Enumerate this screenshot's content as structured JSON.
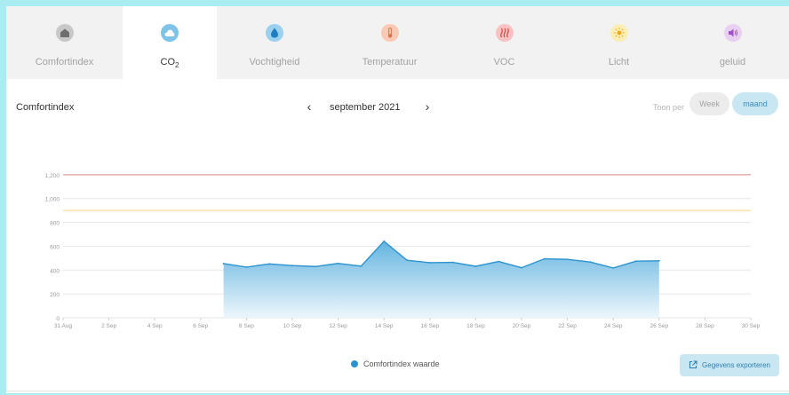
{
  "tabs": [
    {
      "label": "Comfortindex",
      "icon": "house-icon",
      "color": "#c8c8c8",
      "glyph": "#6e6e6e",
      "active": false,
      "width": 131
    },
    {
      "label": "CO",
      "sub": "2",
      "icon": "cloud-icon",
      "color": "#7fc4e8",
      "glyph": "#ffffff",
      "active": true,
      "width": 106
    },
    {
      "label": "Vochtigheid",
      "icon": "droplet-icon",
      "color": "#9cd0ef",
      "glyph": "#1d7fc1",
      "active": false,
      "width": 130
    },
    {
      "label": "Temperatuur",
      "icon": "thermometer-icon",
      "color": "#f9c9b3",
      "glyph": "#e06c4d",
      "active": false,
      "width": 129
    },
    {
      "label": "VOC",
      "icon": "voc-icon",
      "color": "#f8c2c2",
      "glyph": "#d8443b",
      "active": false,
      "width": 129
    },
    {
      "label": "Licht",
      "icon": "sun-icon",
      "color": "#fbedb6",
      "glyph": "#f1a718",
      "active": false,
      "width": 129
    },
    {
      "label": "geluid",
      "icon": "speaker-icon",
      "color": "#e7d0f1",
      "glyph": "#a34fd0",
      "active": false,
      "width": 127
    }
  ],
  "panel": {
    "title": "Comfortindex",
    "prev": "‹",
    "next": "›",
    "month": "september 2021"
  },
  "period": {
    "label": "Toon per",
    "week": "Week",
    "maand": "maand"
  },
  "export": {
    "label": "Gegevens exporteren",
    "icon": "export-icon"
  },
  "colors": {
    "accent": "#2d93cf",
    "threshold_high": "#d98a8a",
    "threshold_mid": "#f2d57c",
    "area_top": "#5ab0df",
    "area_bottom": "#eaf5fb"
  },
  "chart_data": {
    "type": "area",
    "x_ticks": [
      "31 Aug",
      "2 Sep",
      "4 Sep",
      "6 Sep",
      "8 Sep",
      "10 Sep",
      "12 Sep",
      "14 Sep",
      "16 Sep",
      "18 Sep",
      "20 Sep",
      "22 Sep",
      "24 Sep",
      "26 Sep",
      "28 Sep",
      "30 Sep"
    ],
    "y_ticks": [
      "0",
      "200",
      "400",
      "600",
      "800",
      "1,000",
      "1,200"
    ],
    "ylim": [
      0,
      1400
    ],
    "xlim": [
      "31 Aug",
      "30 Sep"
    ],
    "threshold_lines": [
      1200,
      900
    ],
    "grid": true,
    "legend": "bottom-center",
    "series": [
      {
        "name": "Comfortindex waarde",
        "x": [
          "7 Sep",
          "8 Sep",
          "9 Sep",
          "10 Sep",
          "11 Sep",
          "12 Sep",
          "13 Sep",
          "14 Sep",
          "15 Sep",
          "16 Sep",
          "17 Sep",
          "18 Sep",
          "19 Sep",
          "20 Sep",
          "21 Sep",
          "22 Sep",
          "23 Sep",
          "24 Sep",
          "25 Sep",
          "26 Sep"
        ],
        "y": [
          455,
          425,
          452,
          438,
          430,
          456,
          433,
          642,
          483,
          462,
          465,
          432,
          472,
          420,
          495,
          490,
          468,
          418,
          475,
          478
        ]
      }
    ]
  }
}
